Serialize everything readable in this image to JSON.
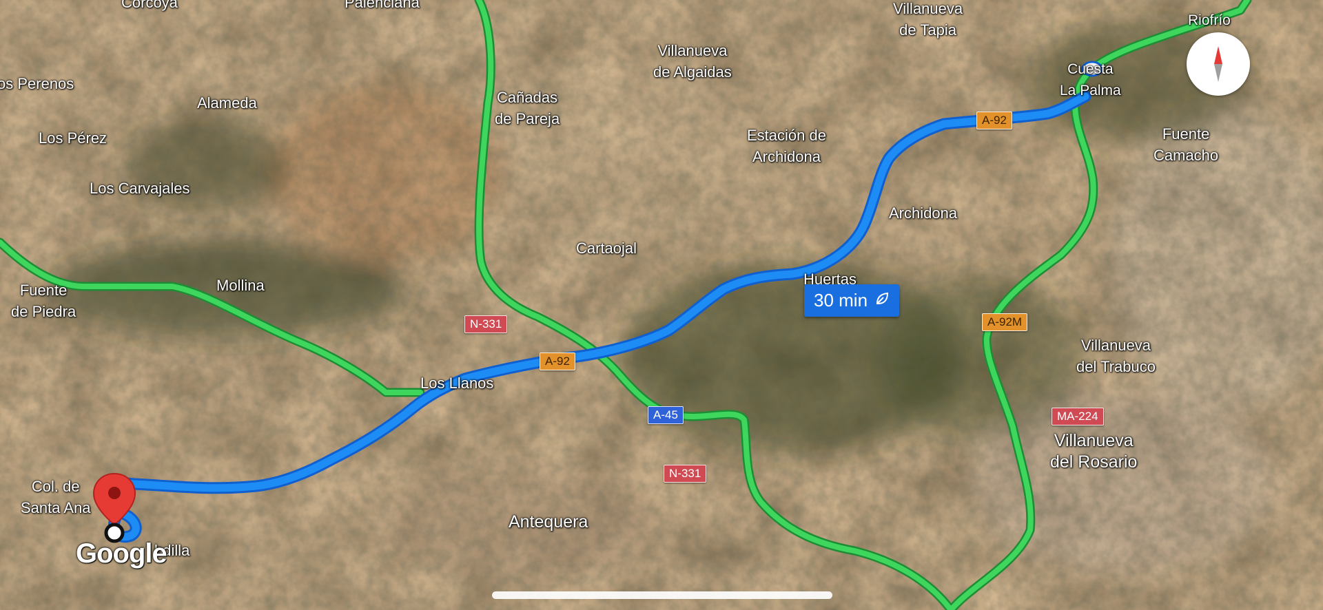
{
  "map": {
    "type": "satellite",
    "colors": {
      "route": "#1d8cf5",
      "route_casing": "#0f5fcf",
      "highway": "#3fd65e",
      "highway_casing": "#1e8c34",
      "pin": "#e63a35",
      "shield_orange": "#e2912b",
      "shield_red": "#cf4a52",
      "shield_blue": "#2f62d8"
    },
    "places": [
      {
        "id": "corcoya",
        "label": "Corcoya"
      },
      {
        "id": "palenciana",
        "label": "Palenciana"
      },
      {
        "id": "villanueva-de-tapia",
        "label": "Villanueva\nde Tapia"
      },
      {
        "id": "riofrio",
        "label": "Riofrío"
      },
      {
        "id": "los-perenos",
        "label": "os Perenos"
      },
      {
        "id": "villanueva-de-algaidas",
        "label": "Villanueva\nde Algaidas"
      },
      {
        "id": "cuesta-la-palma",
        "label": "Cuesta\nLa Palma"
      },
      {
        "id": "alameda",
        "label": "Alameda"
      },
      {
        "id": "canadas-de-pareja",
        "label": "Cañadas\nde Pareja"
      },
      {
        "id": "los-perez",
        "label": "Los Pérez"
      },
      {
        "id": "estacion-de-archidona",
        "label": "Estación de\nArchidona"
      },
      {
        "id": "fuente-camacho",
        "label": "Fuente\nCamacho"
      },
      {
        "id": "los-carvajales",
        "label": "Los Carvajales"
      },
      {
        "id": "archidona",
        "label": "Archidona"
      },
      {
        "id": "cartaojal",
        "label": "Cartaojal"
      },
      {
        "id": "mollina",
        "label": "Mollina"
      },
      {
        "id": "huertas",
        "label": "Huertas"
      },
      {
        "id": "fuente-de-piedra",
        "label": "Fuente\nde Piedra"
      },
      {
        "id": "villanueva-del-trabuco",
        "label": "Villanueva\ndel Trabuco"
      },
      {
        "id": "los-llanos",
        "label": "Los Llanos"
      },
      {
        "id": "villanueva-del-rosario",
        "label": "Villanueva\ndel Rosario"
      },
      {
        "id": "col-santa-ana",
        "label": "Col. de\nSanta Ana"
      },
      {
        "id": "antequera",
        "label": "Antequera"
      },
      {
        "id": "cabdilla",
        "label": "bdilla"
      }
    ],
    "road_shields": [
      {
        "id": "a92-ne",
        "label": "A-92",
        "style": "orange"
      },
      {
        "id": "n331-west",
        "label": "N-331",
        "style": "red"
      },
      {
        "id": "a92-center",
        "label": "A-92",
        "style": "orange"
      },
      {
        "id": "a45",
        "label": "A-45",
        "style": "blue"
      },
      {
        "id": "n331-south",
        "label": "N-331",
        "style": "red"
      },
      {
        "id": "a92m",
        "label": "A-92M",
        "style": "orange"
      },
      {
        "id": "ma224",
        "label": "MA-224",
        "style": "red"
      }
    ],
    "route_eta": {
      "label": "30 min",
      "icon": "leaf-icon"
    },
    "compass_icon": "compass-icon",
    "pin_icon": "destination-pin-icon",
    "attribution": "Google"
  }
}
